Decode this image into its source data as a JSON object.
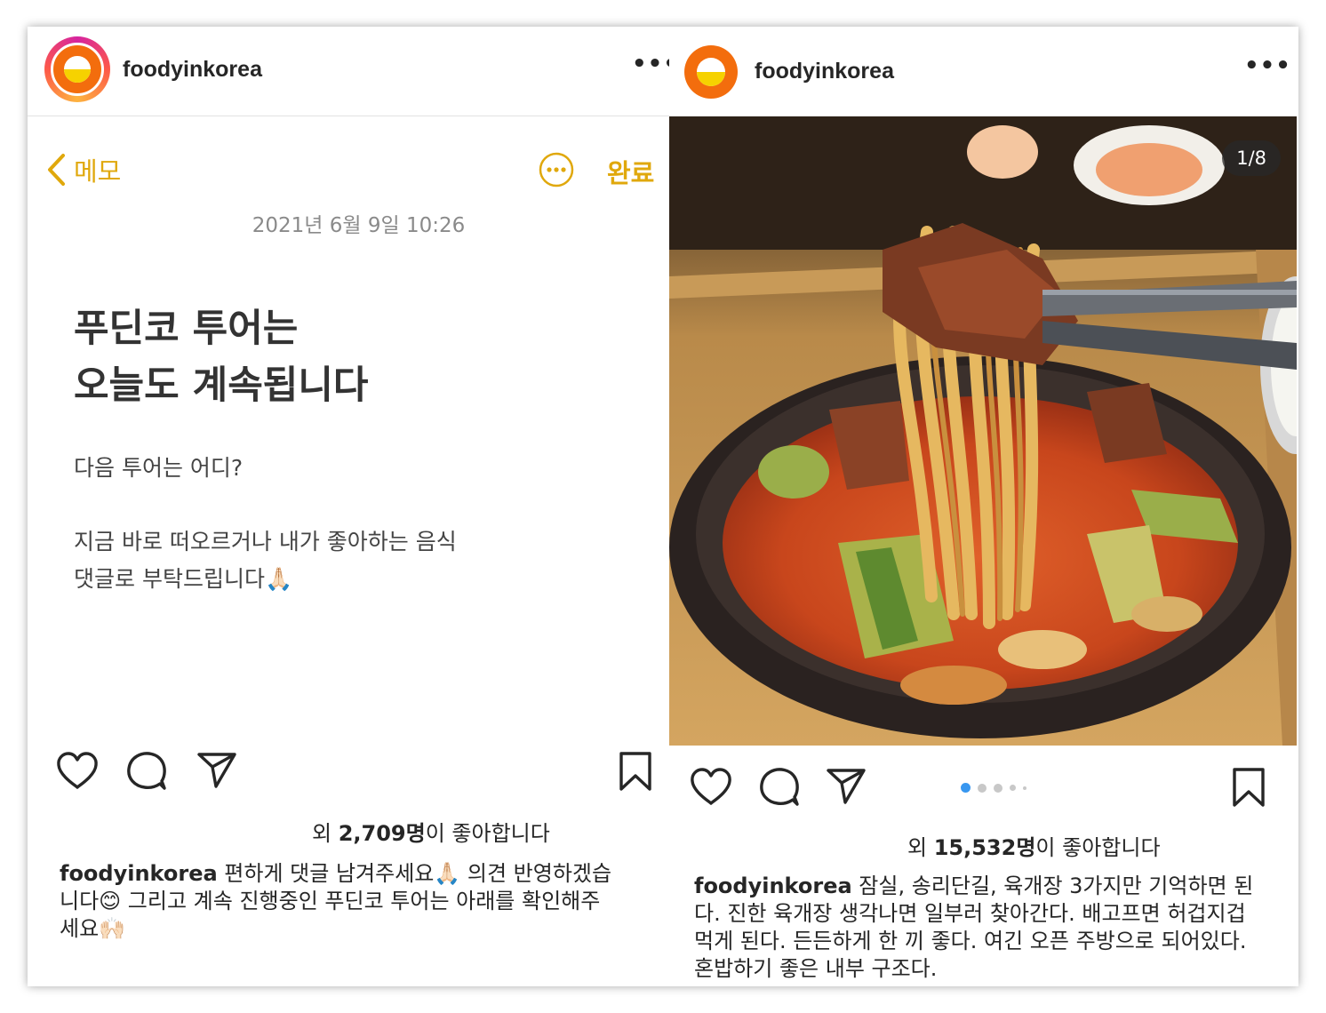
{
  "left_post": {
    "username": "foodyinkorea",
    "more": "•••",
    "memo": {
      "back_label": "메모",
      "done_label": "완료",
      "date": "2021년 6월 9일 10:26",
      "title_line1": "푸딘코 투어는",
      "title_line2": "오늘도 계속됩니다",
      "body_line1": "다음 투어는 어디?",
      "body_line2": "지금 바로 떠오르거나 내가 좋아하는 음식",
      "body_line3": "댓글로 부탁드립니다🙏🏻"
    },
    "likes_prefix": "외 ",
    "likes_count": "2,709명",
    "likes_suffix": "이 좋아합니다",
    "caption_user": "foodyinkorea",
    "caption_line1": " 편하게 댓글 남겨주세요🙏🏻 의견 반영하겠습",
    "caption_line2": "니다😊 그리고 계속 진행중인 푸딘코 투어는 아래를 확인해주",
    "caption_line3": "세요🙌🏻"
  },
  "right_post": {
    "username": "foodyinkorea",
    "more": "•••",
    "photo_counter": "1/8",
    "carousel_active_index": 0,
    "likes_prefix": "외 ",
    "likes_count": "15,532명",
    "likes_suffix": "이 좋아합니다",
    "caption_user": "foodyinkorea",
    "caption_line1": " 잠실, 송리단길, 육개장 3가지만 기억하면 된",
    "caption_line2": "다. 진한 육개장 생각나면 일부러 찾아간다. 배고프면 허겁지겁",
    "caption_line3": "먹게 된다. 든든하게 한 끼 좋다. 여긴 오픈 주방으로 되어있다.",
    "caption_line4": "혼밥하기 좋은 내부 구조다."
  },
  "icons": {
    "like": "heart-icon",
    "comment": "comment-icon",
    "share": "send-icon",
    "save": "bookmark-icon",
    "more": "more-horizontal-icon",
    "back": "chevron-left-icon",
    "options": "ellipsis-circle-icon"
  },
  "colors": {
    "memo_accent": "#e0a80c",
    "carousel_active": "#3897f0",
    "avatar_orange": "#f36d0d",
    "avatar_yellow": "#f6d200",
    "text": "#262626"
  }
}
